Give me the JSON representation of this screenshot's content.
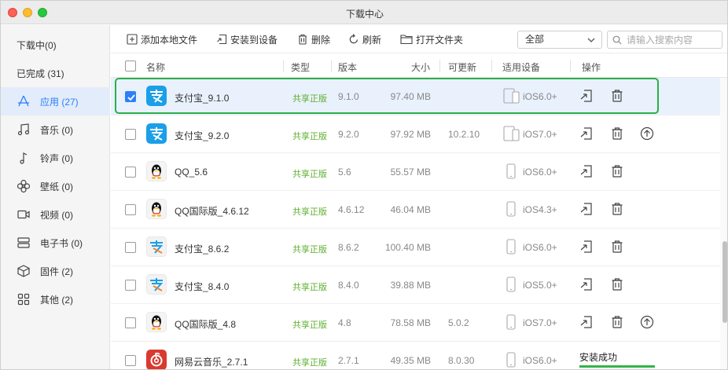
{
  "window": {
    "title": "下载中心"
  },
  "sidebar": {
    "items": [
      {
        "label": "下载中(0)",
        "icon": "none"
      },
      {
        "label": "已完成 (31)",
        "icon": "none"
      },
      {
        "label": "应用 (27)",
        "icon": "app-store-icon",
        "active": true
      },
      {
        "label": "音乐 (0)",
        "icon": "music-note-icon"
      },
      {
        "label": "铃声 (0)",
        "icon": "ringtone-note-icon"
      },
      {
        "label": "壁纸 (0)",
        "icon": "wallpaper-flower-icon"
      },
      {
        "label": "视频 (0)",
        "icon": "video-camera-icon"
      },
      {
        "label": "电子书 (0)",
        "icon": "ebook-icon"
      },
      {
        "label": "固件 (2)",
        "icon": "firmware-cube-icon"
      },
      {
        "label": "其他 (2)",
        "icon": "grid-icon"
      }
    ]
  },
  "toolbar": {
    "add_local": "添加本地文件",
    "install_device": "安装到设备",
    "delete": "删除",
    "refresh": "刷新",
    "open_folder": "打开文件夹",
    "filter_value": "全部",
    "search_placeholder": "请输入搜索内容"
  },
  "table": {
    "headers": {
      "name": "名称",
      "type": "类型",
      "version": "版本",
      "size": "大小",
      "updatable": "可更新",
      "device": "适用设备",
      "actions": "操作"
    },
    "rows": [
      {
        "name": "支付宝_9.1.0",
        "type": "共享正版",
        "version": "9.1.0",
        "size": "97.40 MB",
        "update": "",
        "device": "iOS6.0+",
        "icon": "alipay-icon",
        "checked": true
      },
      {
        "name": "支付宝_9.2.0",
        "type": "共享正版",
        "version": "9.2.0",
        "size": "97.92 MB",
        "update": "10.2.10",
        "device": "iOS7.0+",
        "icon": "alipay-icon",
        "checked": false
      },
      {
        "name": "QQ_5.6",
        "type": "共享正版",
        "version": "5.6",
        "size": "55.57 MB",
        "update": "",
        "device": "iOS6.0+",
        "icon": "qq-penguin-icon",
        "checked": false
      },
      {
        "name": "QQ国际版_4.6.12",
        "type": "共享正版",
        "version": "4.6.12",
        "size": "46.04 MB",
        "update": "",
        "device": "iOS4.3+",
        "icon": "qq-penguin-icon",
        "checked": false
      },
      {
        "name": "支付宝_8.6.2",
        "type": "共享正版",
        "version": "8.6.2",
        "size": "100.40 MB",
        "update": "",
        "device": "iOS6.0+",
        "icon": "alipay-old-icon",
        "checked": false
      },
      {
        "name": "支付宝_8.4.0",
        "type": "共享正版",
        "version": "8.4.0",
        "size": "39.88 MB",
        "update": "",
        "device": "iOS5.0+",
        "icon": "alipay-old-icon",
        "checked": false
      },
      {
        "name": "QQ国际版_4.8",
        "type": "共享正版",
        "version": "4.8",
        "size": "78.58 MB",
        "update": "5.0.2",
        "device": "iOS7.0+",
        "icon": "qq-penguin-icon",
        "checked": false
      },
      {
        "name": "网易云音乐_2.7.1",
        "type": "共享正版",
        "version": "2.7.1",
        "size": "49.35 MB",
        "update": "8.0.30",
        "device": "iOS6.0+",
        "icon": "netease-music-icon",
        "checked": false,
        "status": "安装成功",
        "progress": 1.0
      }
    ]
  },
  "colors": {
    "accent": "#2d7ff9",
    "highlight": "#2bb04a",
    "type_green": "#5fb030"
  }
}
